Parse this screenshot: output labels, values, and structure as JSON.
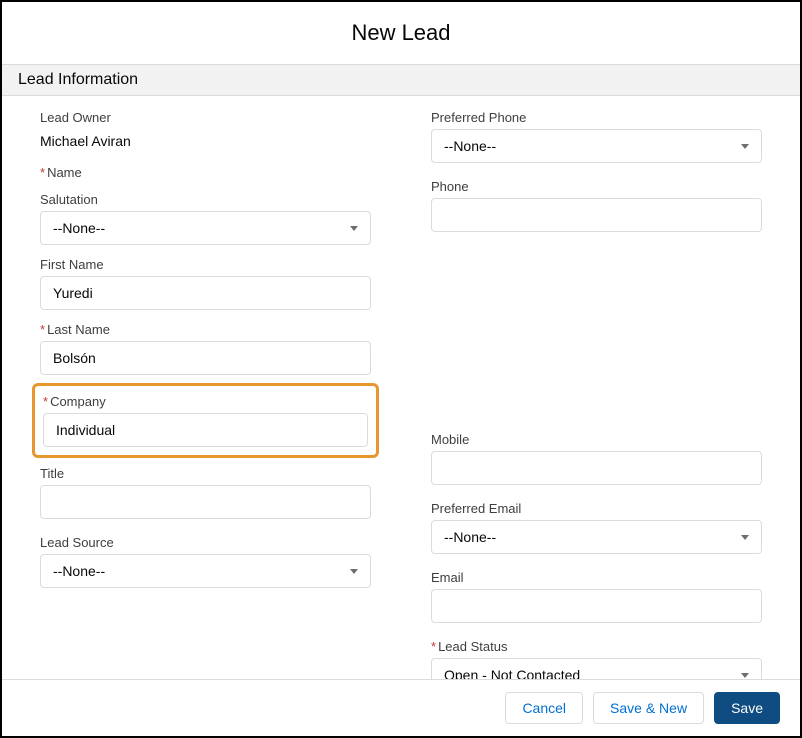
{
  "dialog": {
    "title": "New Lead"
  },
  "section": {
    "title": "Lead Information"
  },
  "labels": {
    "leadOwner": "Lead Owner",
    "name": "Name",
    "salutation": "Salutation",
    "firstName": "First Name",
    "lastName": "Last Name",
    "company": "Company",
    "title": "Title",
    "leadSource": "Lead Source",
    "preferredPhone": "Preferred Phone",
    "phone": "Phone",
    "mobile": "Mobile",
    "preferredEmail": "Preferred Email",
    "email": "Email",
    "leadStatus": "Lead Status"
  },
  "values": {
    "leadOwner": "Michael Aviran",
    "salutation": "--None--",
    "firstName": "Yuredi",
    "lastName": "Bolsón",
    "company": "Individual",
    "title": "",
    "leadSource": "--None--",
    "preferredPhone": "--None--",
    "phone": "",
    "mobile": "",
    "preferredEmail": "--None--",
    "email": "",
    "leadStatus": "Open - Not Contacted"
  },
  "buttons": {
    "cancel": "Cancel",
    "saveNew": "Save & New",
    "save": "Save"
  }
}
